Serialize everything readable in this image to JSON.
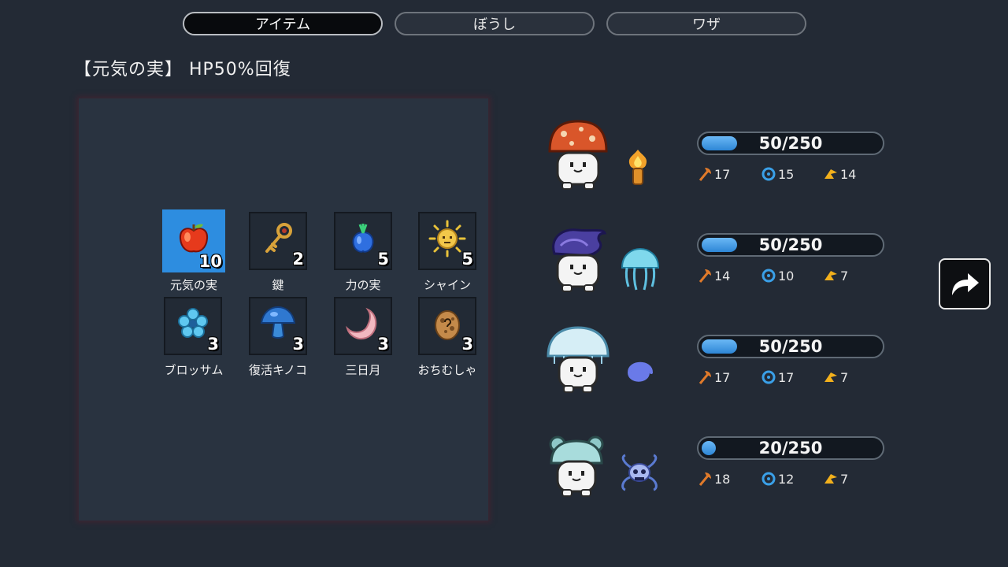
{
  "tabs": [
    {
      "label": "アイテム",
      "active": true
    },
    {
      "label": "ぼうし",
      "active": false
    },
    {
      "label": "ワザ",
      "active": false
    }
  ],
  "description": "【元気の実】 HP50%回復",
  "items": [
    {
      "name": "元気の実",
      "count": "10",
      "icon": "apple-icon",
      "selected": true
    },
    {
      "name": "鍵",
      "count": "2",
      "icon": "key-icon"
    },
    {
      "name": "力の実",
      "count": "5",
      "icon": "blue-fruit-icon"
    },
    {
      "name": "シャイン",
      "count": "5",
      "icon": "sun-icon"
    },
    {
      "name": "ブロッサム",
      "count": "3",
      "icon": "blossom-icon"
    },
    {
      "name": "復活キノコ",
      "count": "3",
      "icon": "mushroom-icon"
    },
    {
      "name": "三日月",
      "count": "3",
      "icon": "crescent-moon-icon"
    },
    {
      "name": "おちむしゃ",
      "count": "3",
      "icon": "egg-icon"
    }
  ],
  "party": [
    {
      "hat": "red-mushroom-hat",
      "weapon": "flame-hand-icon",
      "hp": 50,
      "hp_max": 250,
      "hp_text": "50/250",
      "attack": "17",
      "defense": "15",
      "speed": "14"
    },
    {
      "hat": "purple-swirl-hat",
      "weapon": "jellyfish-icon",
      "hp": 50,
      "hp_max": 250,
      "hp_text": "50/250",
      "attack": "14",
      "defense": "10",
      "speed": "7"
    },
    {
      "hat": "jellyfish-hat",
      "weapon": "spiral-icon",
      "hp": 50,
      "hp_max": 250,
      "hp_text": "50/250",
      "attack": "17",
      "defense": "17",
      "speed": "7"
    },
    {
      "hat": "bear-ear-hat",
      "weapon": "skull-tentacle-icon",
      "hp": 20,
      "hp_max": 250,
      "hp_text": "20/250",
      "attack": "18",
      "defense": "12",
      "speed": "7"
    }
  ],
  "stat_icons": {
    "attack": "axe-icon",
    "defense": "ring-icon",
    "speed": "wing-icon"
  },
  "colors": {
    "accent": "#2d8de0",
    "background": "#232a35",
    "panel": "#293340",
    "hp_fill": "#3a95e3"
  }
}
